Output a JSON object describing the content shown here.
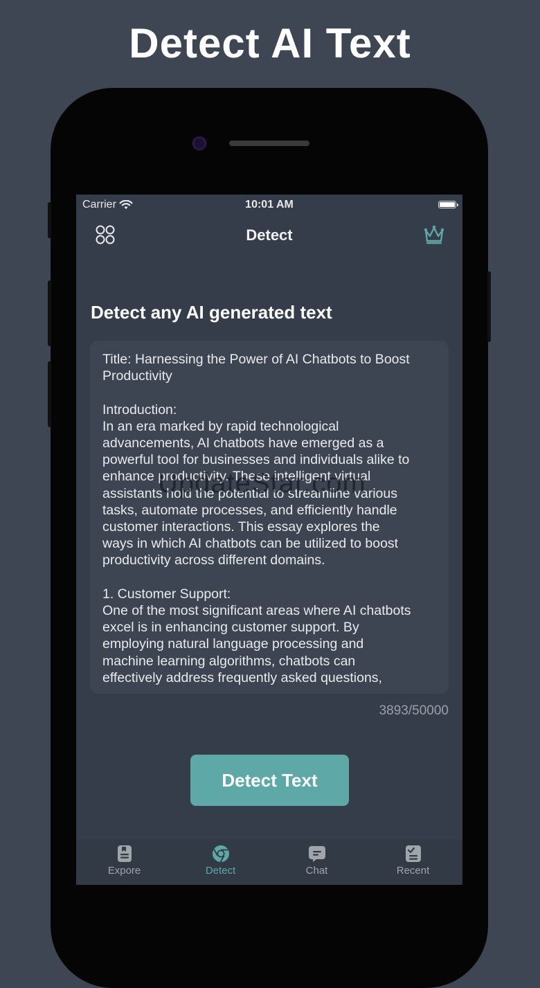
{
  "headline": "Detect AI Text",
  "status_bar": {
    "carrier": "Carrier",
    "time": "10:01 AM"
  },
  "nav": {
    "title": "Detect",
    "left_icon": "grid-icon",
    "right_icon": "crown-icon"
  },
  "main": {
    "heading": "Detect any AI generated text",
    "input_text": "Title: Harnessing the Power of AI Chatbots to Boost\nProductivity\n\nIntroduction:\nIn an era marked by rapid technological\nadvancements, AI chatbots have emerged as a\npowerful tool for businesses and individuals alike to\nenhance productivity. These intelligent virtual\nassistants hold the potential to streamline various\ntasks, automate processes, and efficiently handle\ncustomer interactions. This essay explores the\nways in which AI chatbots can be utilized to boost\nproductivity across different domains.\n\n1. Customer Support:\nOne of the most significant areas where AI chatbots\nexcel is in enhancing customer support. By\nemploying natural language processing and\nmachine learning algorithms, chatbots can\neffectively address frequently asked questions,",
    "watermark": "UpdateStar.com",
    "char_count": "3893/50000",
    "detect_button": "Detect Text"
  },
  "tabs": [
    {
      "label": "Expore",
      "icon": "document-icon",
      "active": false
    },
    {
      "label": "Detect",
      "icon": "chrome-icon",
      "active": true
    },
    {
      "label": "Chat",
      "icon": "chat-icon",
      "active": false
    },
    {
      "label": "Recent",
      "icon": "checklist-icon",
      "active": false
    }
  ],
  "colors": {
    "accent": "#5fa8a8",
    "background": "#3e4553",
    "screen": "#353d4a"
  }
}
